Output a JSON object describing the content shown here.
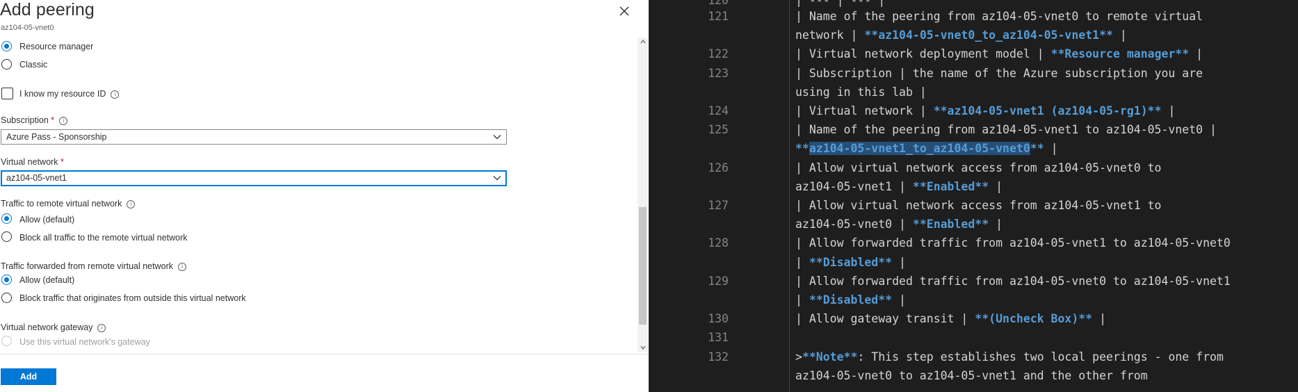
{
  "panel": {
    "title": "Add peering",
    "subtitle": "az104-05-vnet0",
    "deployment_model": {
      "options": [
        "Resource manager",
        "Classic"
      ],
      "selected": "Resource manager"
    },
    "resource_id_checkbox": {
      "label": "I know my resource ID",
      "checked": false
    },
    "subscription": {
      "label": "Subscription",
      "required_mark": "*",
      "value": "Azure Pass - Sponsorship"
    },
    "virtual_network": {
      "label": "Virtual network",
      "required_mark": "*",
      "value": "az104-05-vnet1"
    },
    "traffic_to_remote": {
      "label": "Traffic to remote virtual network",
      "options": [
        "Allow (default)",
        "Block all traffic to the remote virtual network"
      ],
      "selected": "Allow (default)"
    },
    "traffic_forwarded": {
      "label": "Traffic forwarded from remote virtual network",
      "options": [
        "Allow (default)",
        "Block traffic that originates from outside this virtual network"
      ],
      "selected": "Allow (default)"
    },
    "gateway": {
      "label": "Virtual network gateway",
      "option": "Use this virtual network's gateway",
      "disabled": true
    },
    "add_button": "Add",
    "info_glyph": "i",
    "colors": {
      "accent": "#0078d4",
      "required": "#a4262c"
    }
  },
  "editor": {
    "colors": {
      "background": "#1e1e1e",
      "text": "#d4d4d4",
      "bold": "#569cd6",
      "line_number": "#858585",
      "selection": "#264f78"
    },
    "partial_top_line": "| --- | --- |",
    "lines": [
      {
        "num": "121",
        "rows": [
          [
            {
              "t": "| Name of the peering from az104-05-vnet0 to remote virtual"
            }
          ],
          [
            {
              "t": "network | "
            },
            {
              "t": "**az104-05-vnet0_to_az104-05-vnet1**",
              "b": true
            },
            {
              "t": " |"
            }
          ]
        ]
      },
      {
        "num": "122",
        "rows": [
          [
            {
              "t": "| Virtual network deployment model | "
            },
            {
              "t": "**Resource manager**",
              "b": true
            },
            {
              "t": " |"
            }
          ]
        ]
      },
      {
        "num": "123",
        "rows": [
          [
            {
              "t": "| Subscription | the name of the Azure subscription you are"
            }
          ],
          [
            {
              "t": "using in this lab |"
            }
          ]
        ]
      },
      {
        "num": "124",
        "rows": [
          [
            {
              "t": "| Virtual network | "
            },
            {
              "t": "**az104-05-vnet1 (az104-05-rg1)**",
              "b": true
            },
            {
              "t": " |"
            }
          ]
        ]
      },
      {
        "num": "125",
        "rows": [
          [
            {
              "t": "| Name of the peering from az104-05-vnet1 to az104-05-vnet0 |"
            }
          ],
          [
            {
              "t": "**",
              "b": true
            },
            {
              "t": "az104-05-vnet1_to_az104-05-vnet0",
              "b": true,
              "s": true
            },
            {
              "t": "**",
              "b": true
            },
            {
              "t": " |"
            }
          ]
        ]
      },
      {
        "num": "126",
        "rows": [
          [
            {
              "t": "| Allow virtual network access from az104-05-vnet0 to"
            }
          ],
          [
            {
              "t": "az104-05-vnet1 | "
            },
            {
              "t": "**Enabled**",
              "b": true
            },
            {
              "t": " |"
            }
          ]
        ]
      },
      {
        "num": "127",
        "rows": [
          [
            {
              "t": "| Allow virtual network access from az104-05-vnet1 to"
            }
          ],
          [
            {
              "t": "az104-05-vnet0 | "
            },
            {
              "t": "**Enabled**",
              "b": true
            },
            {
              "t": " |"
            }
          ]
        ]
      },
      {
        "num": "128",
        "rows": [
          [
            {
              "t": "| Allow forwarded traffic from az104-05-vnet1 to az104-05-vnet0"
            }
          ],
          [
            {
              "t": "| "
            },
            {
              "t": "**Disabled**",
              "b": true
            },
            {
              "t": " |"
            }
          ]
        ]
      },
      {
        "num": "129",
        "rows": [
          [
            {
              "t": "| Allow forwarded traffic from az104-05-vnet0 to az104-05-vnet1"
            }
          ],
          [
            {
              "t": "| "
            },
            {
              "t": "**Disabled**",
              "b": true
            },
            {
              "t": " |"
            }
          ]
        ]
      },
      {
        "num": "130",
        "rows": [
          [
            {
              "t": "| Allow gateway transit | "
            },
            {
              "t": "**(Uncheck Box)**",
              "b": true
            },
            {
              "t": " |"
            }
          ]
        ]
      },
      {
        "num": "131",
        "rows": [
          [
            {
              "t": ""
            }
          ]
        ]
      },
      {
        "num": "132",
        "rows": [
          [
            {
              "t": ">"
            },
            {
              "t": "**Note**",
              "b": true
            },
            {
              "t": ": This step establishes two local peerings - one from"
            }
          ],
          [
            {
              "t": "az104-05-vnet0 to az104-05-vnet1 and the other from"
            }
          ]
        ]
      }
    ]
  }
}
